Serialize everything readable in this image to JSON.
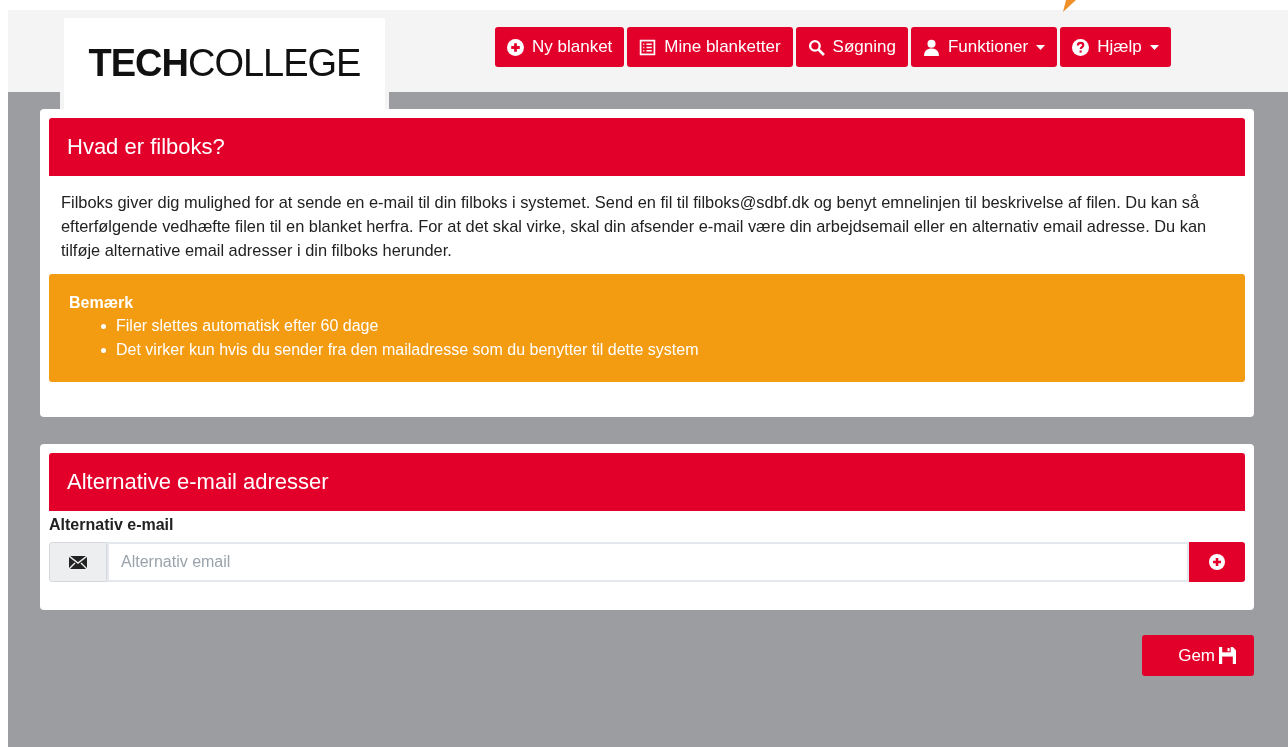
{
  "logo": {
    "bold": "TECH",
    "light": "COLLEGE"
  },
  "nav": [
    {
      "label": "Ny blanket",
      "kind": "new",
      "dropdown": false
    },
    {
      "label": "Mine blanketter",
      "kind": "list",
      "dropdown": false
    },
    {
      "label": "Søgning",
      "kind": "search",
      "dropdown": false
    },
    {
      "label": "Funktioner",
      "kind": "user",
      "dropdown": true
    },
    {
      "label": "Hjælp",
      "kind": "help",
      "dropdown": true
    }
  ],
  "info_panel": {
    "title": "Hvad er filboks?",
    "text": "Filboks giver dig mulighed for at sende en e-mail til din filboks i systemet. Send en fil til filboks@sdbf.dk og benyt emnelinjen til beskrivelse af filen. Du kan så efterfølgende vedhæfte filen til en blanket herfra. For at det skal virke, skal din afsender e-mail være din arbejdsemail eller en alternativ email adresse. Du kan tilføje alternative email adresser i din filboks herunder.",
    "note": {
      "title": "Bemærk",
      "items": [
        "Filer slettes automatisk efter 60 dage",
        "Det virker kun hvis du sender fra den mailadresse som du benytter til dette system"
      ]
    }
  },
  "email_panel": {
    "title": "Alternative e-mail adresser",
    "label": "Alternativ e-mail",
    "placeholder": "Alternativ email"
  },
  "save_button": "Gem"
}
